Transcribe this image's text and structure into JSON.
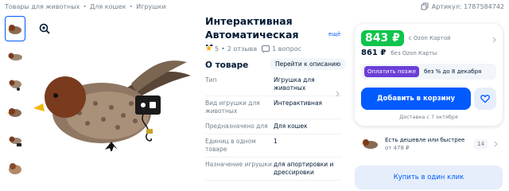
{
  "breadcrumb": [
    "Товары для животных",
    "Для кошек",
    "Игрушки"
  ],
  "breadcrumb_separator": "•",
  "article": {
    "label": "Артикул: 1787584742"
  },
  "product": {
    "title": "Интерактивная Автоматическая Игрушка",
    "title_more": "ещё",
    "rating": "5",
    "reviews": "2 отзыва",
    "questions": "1 вопрос"
  },
  "about": {
    "heading": "О товаре",
    "goto_description": "Перейти к описанию",
    "specs": [
      {
        "key": "Тип",
        "value": "Игрушка для животных"
      },
      {
        "key": "Вид игрушки для животных",
        "value": "Интерактивная"
      },
      {
        "key": "Предназначено для",
        "value": "Для кошек"
      },
      {
        "key": "Единиц в одном товаре",
        "value": "1"
      },
      {
        "key": "Назначение игрушки",
        "value": "для апортировки и дрессировки"
      }
    ]
  },
  "offer": {
    "price_card": "843 ₽",
    "price_card_note": "с Ozon Картой",
    "price_regular": "861 ₽",
    "price_regular_note": "без Ozon Карты",
    "installment_button": "Оплатить позже",
    "installment_text": "без % до 8 декабря",
    "add_to_cart": "Добавить в корзину",
    "delivery": "Доставка с 7 октября"
  },
  "cheaper": {
    "text": "Есть дешевле или быстрее",
    "price": "от 478 ₽",
    "count": "14"
  },
  "buy_one_click": "Купить в один клик",
  "colors": {
    "accent": "#005bff",
    "price_green": "#10c44c",
    "installment_purple": "#6b3fd8",
    "star": "#ffa800"
  }
}
